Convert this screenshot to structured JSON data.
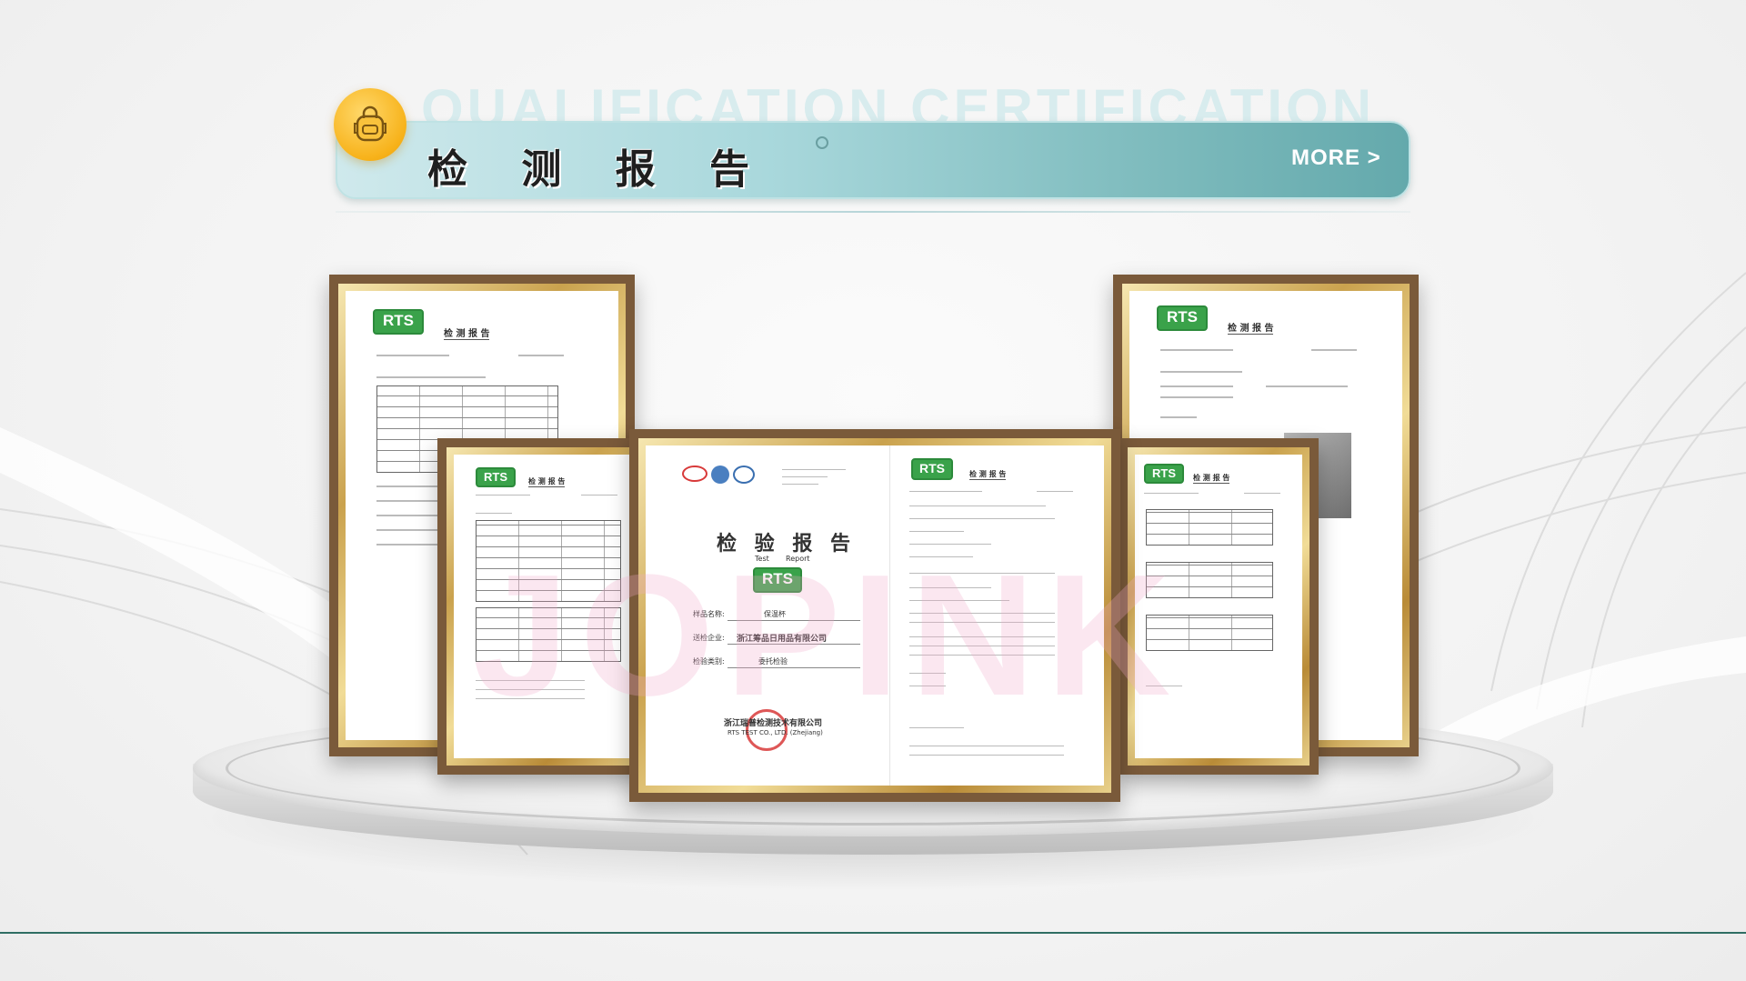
{
  "header": {
    "ghost_title": "QUALIFICATION CERTIFICATION",
    "title": "检 测 报 告",
    "more_label": "MORE >",
    "badge_icon": "bag-icon"
  },
  "certificates": {
    "brand": "RTS",
    "report_title": "检 测 报 告",
    "front": {
      "title": "检 验 报 告",
      "title_en_test": "Test",
      "title_en_report": "Report",
      "sample_label": "样品名称:",
      "sample_value": "保温杯",
      "applicant_label": "送检企业:",
      "applicant_value": "浙江筹品日用品有限公司",
      "category_label": "检验类别:",
      "category_value": "委托检验",
      "lab_name": "浙江瑞普检测技术有限公司",
      "lab_name_en": "RTS TEST CO., LTD. (Zhejiang)"
    },
    "watermark": "JOPINK"
  },
  "colors": {
    "accent": "#64a9ac",
    "badge": "#f7b21a",
    "frame": "#7a5a3a",
    "brand_green": "#3aa24a"
  }
}
